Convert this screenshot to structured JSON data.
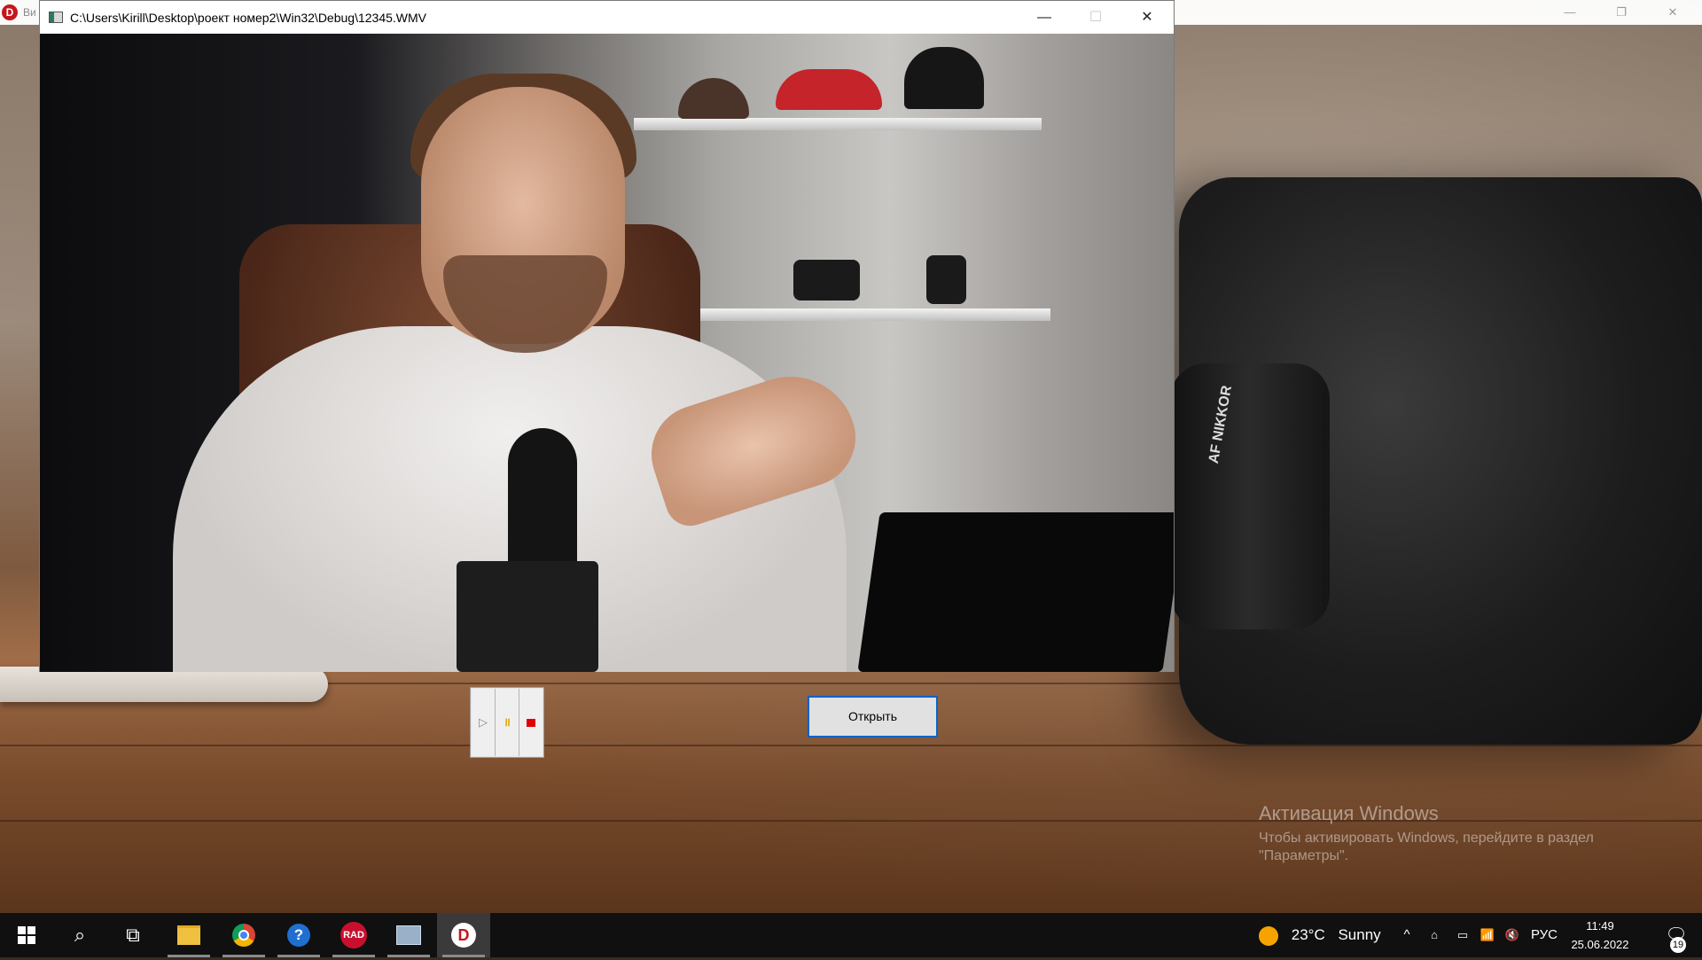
{
  "background_app": {
    "title": "Ви",
    "logo_letter": "D",
    "minimize_glyph": "—",
    "maximize_glyph": "❐",
    "close_glyph": "✕"
  },
  "player_window": {
    "title": "C:\\Users\\Kirill\\Desktop\\роект номер2\\Win32\\Debug\\12345.WMV",
    "minimize_glyph": "—",
    "maximize_glyph": "☐",
    "close_glyph": "✕",
    "video_camera_brand": "AF NIKKOR"
  },
  "controls": {
    "play_glyph": "▷",
    "pause_glyph": "॥",
    "open_label": "Открыть"
  },
  "watermark": {
    "line1": "Активация Windows",
    "line2": "Чтобы активировать Windows, перейдите в раздел",
    "line3": "\"Параметры\"."
  },
  "taskbar": {
    "search_glyph": "⌕",
    "taskview_glyph": "⧉",
    "help_glyph": "?",
    "rad_label": "RAD",
    "d_label": "D",
    "weather_temp": "23°C",
    "weather_text": "Sunny",
    "tray_chevron": "^",
    "tray_volume": "🔇",
    "tray_network": "📶",
    "language": "РУС",
    "time": "11:49",
    "date": "25.06.2022",
    "notifications_count": "19",
    "notification_glyph": "🗨"
  },
  "colors": {
    "accent": "#0a64c8",
    "stop_red": "#e00000",
    "pause_yellow": "#e0a800",
    "taskbar": "#101010"
  }
}
